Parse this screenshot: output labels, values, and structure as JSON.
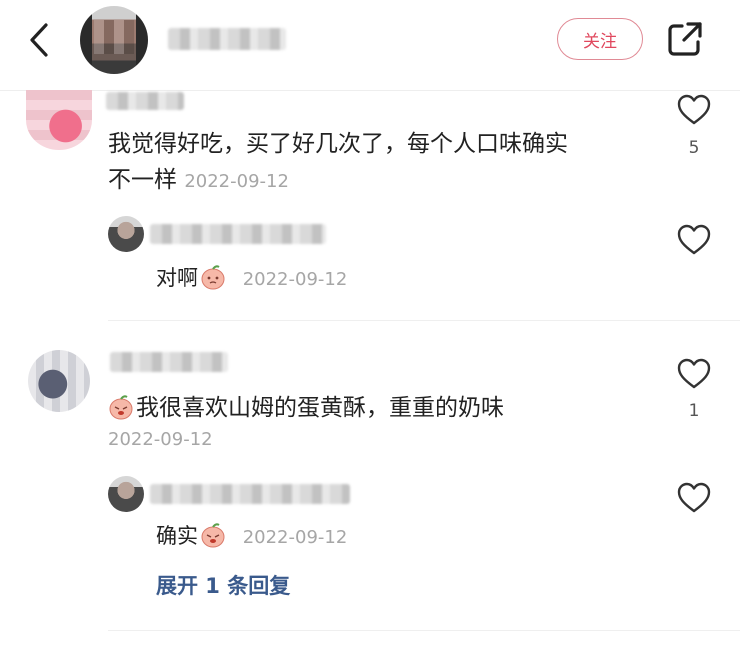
{
  "header": {
    "follow_label": "关注"
  },
  "comments": [
    {
      "text": "我觉得好吃，买了好几次了，每个人口味确实",
      "text_line2": "不一样",
      "date": "2022-09-12",
      "likes": "5",
      "reply": {
        "text": "对啊",
        "date": "2022-09-12"
      }
    },
    {
      "text": "我很喜欢山姆的蛋黄酥，重重的奶味",
      "date": "2022-09-12",
      "likes": "1",
      "reply": {
        "text": "确实",
        "date": "2022-09-12"
      },
      "expand_label": "展开 1 条回复"
    }
  ],
  "colors": {
    "accent": "#e0485e",
    "link": "#3a5a8c",
    "date": "#a6a6a6"
  }
}
